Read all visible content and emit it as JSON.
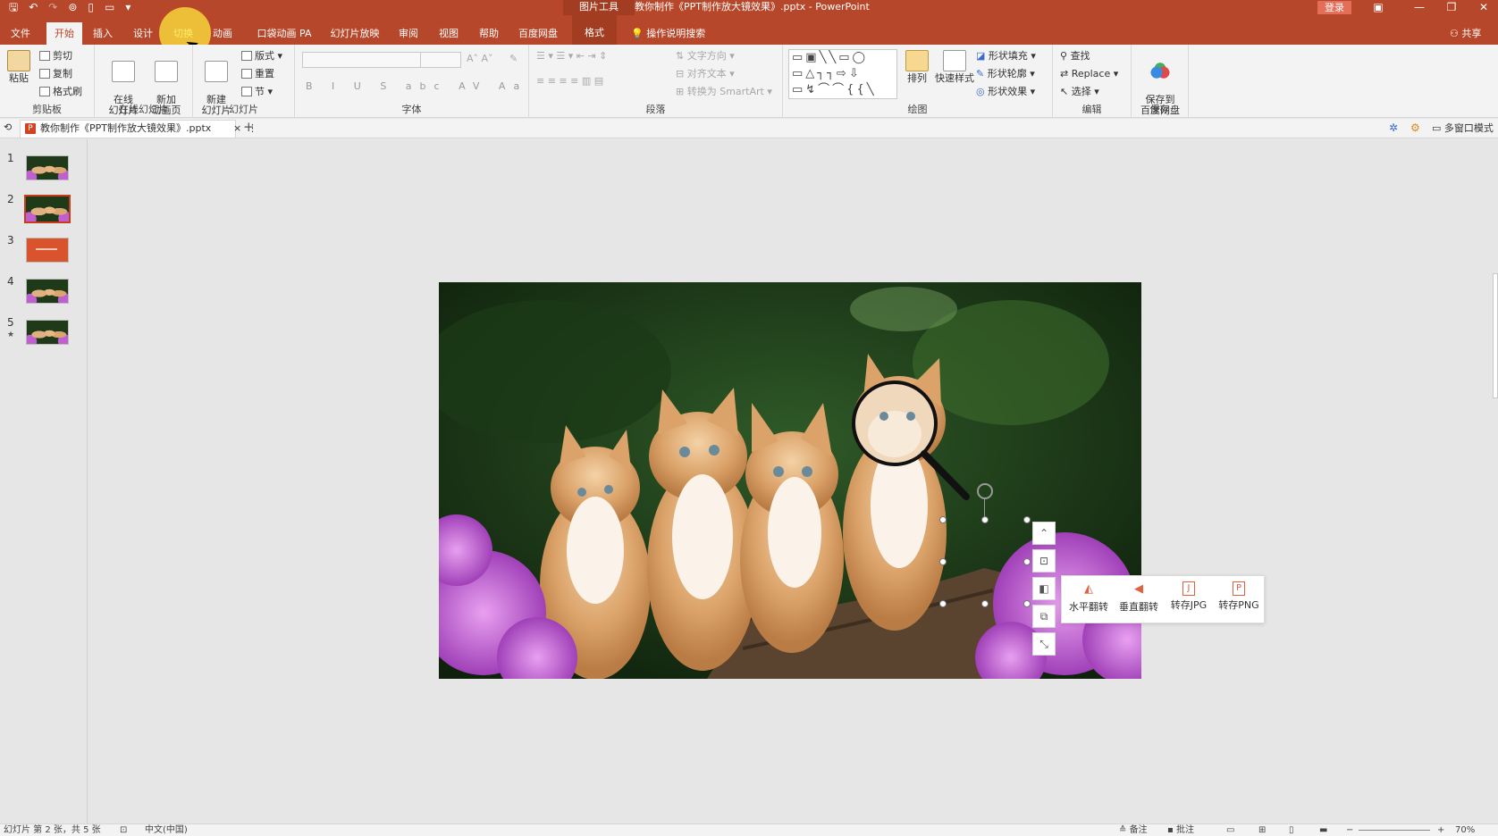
{
  "titlebar": {
    "qat_icons": [
      "save-icon",
      "undo-icon",
      "redo-icon",
      "touch-mode-icon",
      "new-file-icon",
      "open-folder-icon",
      "customize-icon"
    ],
    "context_tools": "图片工具",
    "doc_title": "教你制作《PPT制作放大镜效果》.pptx - PowerPoint",
    "login": "登录",
    "colors": {
      "accent": "#b7472a",
      "accent_dark": "#a33d22",
      "login_bg": "#e56e58"
    }
  },
  "tabs": {
    "file": "文件",
    "home": "开始",
    "insert": "插入",
    "design": "设计",
    "transitions": "切换",
    "animations": "动画",
    "pocket_anim": "口袋动画 PA",
    "slideshow": "幻灯片放映",
    "review": "审阅",
    "view": "视图",
    "help": "帮助",
    "baidu": "百度网盘",
    "format": "格式",
    "tell_me": "操作说明搜索",
    "share": "共享"
  },
  "ribbon": {
    "clipboard": {
      "paste": "粘贴",
      "cut": "剪切",
      "copy": "复制",
      "format_painter": "格式刷",
      "label": "剪贴板"
    },
    "online_slides": {
      "online": "在线\n幻灯片",
      "add_anim": "新加\n动画页",
      "label": "在线幻灯片"
    },
    "slides": {
      "new_slide": "新建\n幻灯片",
      "layout": "版式",
      "reset": "重置",
      "section": "节",
      "label": "幻灯片"
    },
    "font": {
      "format_buttons": "B I U S abc AV Aa",
      "label": "字体"
    },
    "paragraph": {
      "text_direction": "文字方向",
      "align_text": "对齐文本",
      "smartart": "转换为 SmartArt",
      "label": "段落"
    },
    "drawing": {
      "arrange": "排列",
      "quick_styles": "快速样式",
      "shape_fill": "形状填充",
      "shape_outline": "形状轮廓",
      "shape_effects": "形状效果",
      "label": "绘图"
    },
    "editing": {
      "find": "查找",
      "replace": "Replace",
      "select": "选择",
      "label": "编辑"
    },
    "save": {
      "save_baidu": "保存到\n百度网盘",
      "label": "保存"
    }
  },
  "doc_tab": {
    "title": "教你制作《PPT制作放大镜效果》.pptx",
    "close": "×",
    "more": "⋮",
    "add": "+",
    "multi_window": "多窗口模式"
  },
  "thumbnails": [
    {
      "num": "1",
      "kind": "photo",
      "selected": false
    },
    {
      "num": "2",
      "kind": "photo",
      "selected": true
    },
    {
      "num": "3",
      "kind": "red",
      "selected": false
    },
    {
      "num": "4",
      "kind": "photo",
      "selected": false
    },
    {
      "num": "5",
      "kind": "photo",
      "selected": false,
      "has_star": true
    }
  ],
  "float_menu": {
    "flip_h": "水平翻转",
    "flip_v": "垂直翻转",
    "save_jpg": "转存JPG",
    "save_png": "转存PNG"
  },
  "status": {
    "slide_info": "幻灯片 第 2 张，共 5 张",
    "language": "中文(中国)",
    "notes": "备注",
    "comments": "批注",
    "zoom": "70%"
  }
}
